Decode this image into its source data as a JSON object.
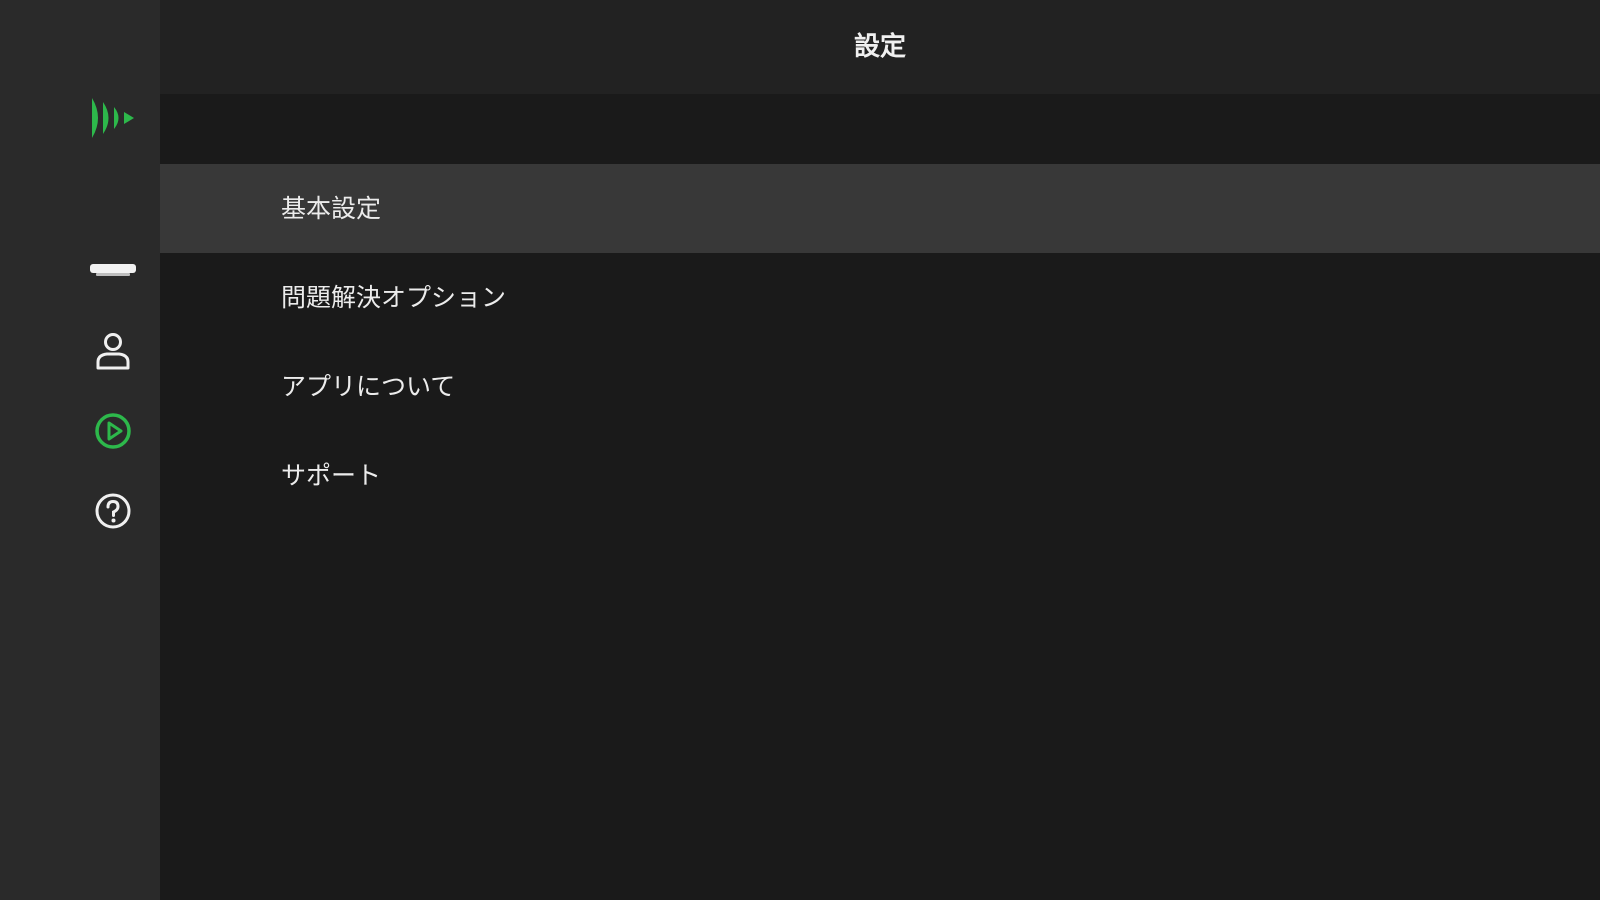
{
  "header": {
    "title": "設定"
  },
  "sidebar": {
    "logo": "app-logo-icon",
    "items": [
      {
        "icon": "device-icon"
      },
      {
        "icon": "user-icon"
      },
      {
        "icon": "play-circle-icon",
        "active": true
      },
      {
        "icon": "help-icon"
      }
    ],
    "accent_color": "#2db84b"
  },
  "menu": {
    "items": [
      {
        "label": "基本設定",
        "selected": true
      },
      {
        "label": "問題解決オプション"
      },
      {
        "label": "アプリについて"
      },
      {
        "label": "サポート"
      }
    ]
  }
}
